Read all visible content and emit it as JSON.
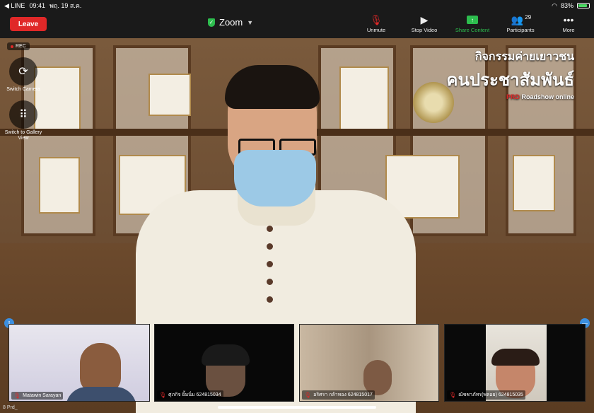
{
  "status_bar": {
    "back_app": "◀ LINE",
    "time": "09:41",
    "date": "พฤ. 19 ส.ค.",
    "battery": "83%",
    "battery_level": 0.83
  },
  "top_bar": {
    "leave_label": "Leave",
    "title": "Zoom",
    "toolbar": [
      {
        "label": "Unmute",
        "icon": "mic-off-icon"
      },
      {
        "label": "Stop Video",
        "icon": "video-icon"
      },
      {
        "label": "Share Content",
        "icon": "share-icon"
      },
      {
        "label": "Participants",
        "icon": "participants-icon",
        "count": "29"
      },
      {
        "label": "More",
        "icon": "more-icon"
      }
    ]
  },
  "main_video": {
    "rec_label": "REC",
    "switch_camera_label": "Switch Camera",
    "gallery_view_label": "Switch to Gallery View",
    "overlay": {
      "line1": "กิจกรรมค่ายเยาวชน",
      "line2": "คนประชาสัมพันธ์",
      "line3_prefix": "PRD",
      "line3_suffix": " Roadshow online"
    }
  },
  "participants": [
    {
      "name": "Matawin Sarayan",
      "muted": true
    },
    {
      "name": "ศุภกิจ ยิ้มนิ่ม 624815034",
      "muted": true
    },
    {
      "name": "อริศรา กล้าทอง 624815017",
      "muted": true
    },
    {
      "name": "ณัชชาภัทร(พลอย) 624815035",
      "muted": true
    }
  ],
  "bottom_text": "8 Prd_",
  "colors": {
    "leave": "#e02828",
    "share": "#2dbd4e",
    "accent_blue": "#3b8fe0"
  }
}
